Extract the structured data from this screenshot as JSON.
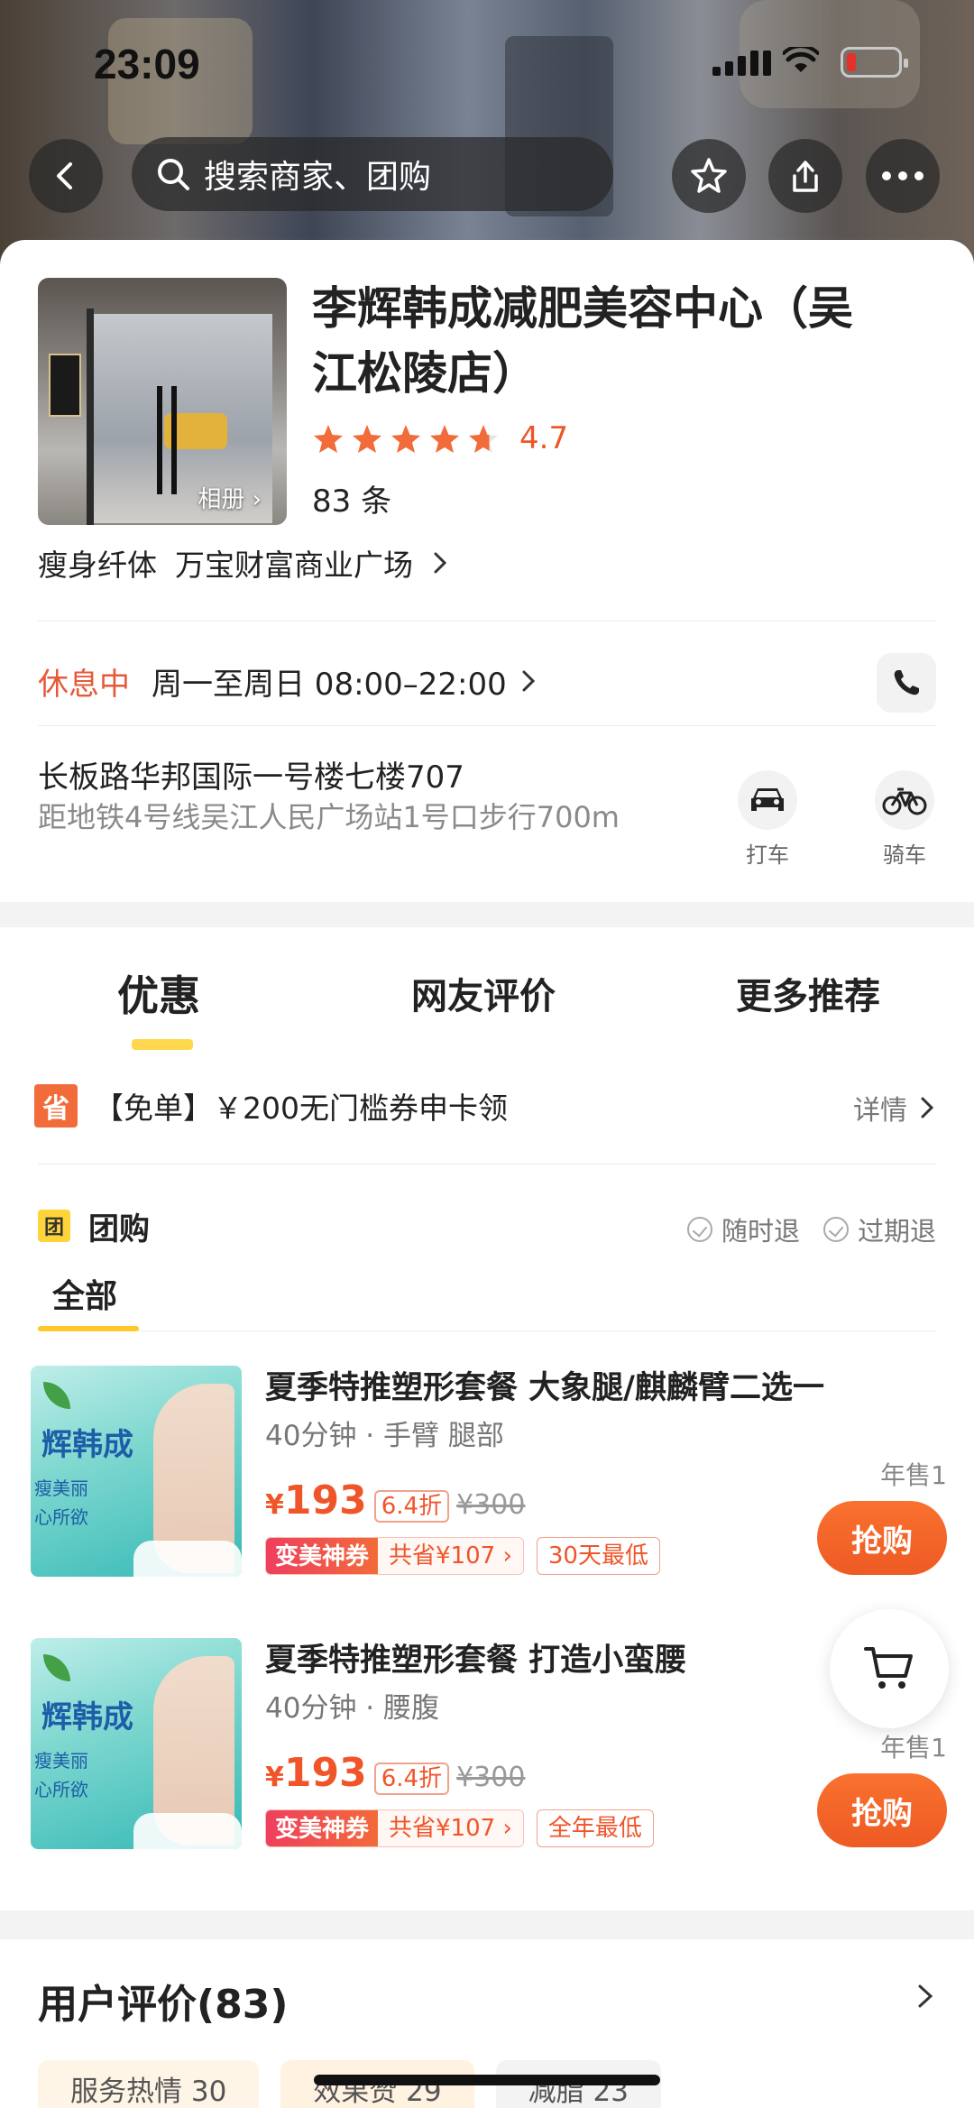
{
  "status_bar": {
    "time": "23:09"
  },
  "search": {
    "placeholder": "搜索商家、团购"
  },
  "shop": {
    "name": "李辉韩成减肥美容中心（吴江松陵店）",
    "name_line1": "李辉韩成减肥美容中心（吴",
    "name_line2": "江松陵店）",
    "rating": "4.7",
    "review_count": "83 条",
    "album_label": "相册 ›",
    "category": "瘦身纤体",
    "mall": "万宝财富商业广场",
    "hours_status": "休息中",
    "hours": "周一至周日 08:00–22:00",
    "address": "长板路华邦国际一号楼七楼707",
    "distance": "距地铁4号线吴江人民广场站1号口步行700m",
    "route_taxi": "打车",
    "route_bike": "骑车"
  },
  "tabs": [
    "优惠",
    "网友评价",
    "更多推荐"
  ],
  "coupon": {
    "badge": "省",
    "text": "【免单】￥200无门槛券申卡领",
    "detail": "详情"
  },
  "group": {
    "badge": "团",
    "title": "团购",
    "refund_any": "随时退",
    "refund_expire": "过期退",
    "subtab": "全部"
  },
  "deals": [
    {
      "title": "夏季特推塑形套餐 大象腿/麒麟臂二选一",
      "meta": "40分钟 · 手臂 腿部",
      "price_symbol": "¥",
      "price": "193",
      "discount": "6.4折",
      "original": "¥300",
      "tag_left": "变美神券",
      "tag_right": "共省¥107 ›",
      "tag_extra": "30天最低",
      "sales": "年售1",
      "buy": "抢购",
      "img_brand": "辉韩成",
      "img_sub1": "瘦美丽",
      "img_sub2": "心所欲"
    },
    {
      "title": "夏季特推塑形套餐 打造小蛮腰",
      "meta": "40分钟 · 腰腹",
      "price_symbol": "¥",
      "price": "193",
      "discount": "6.4折",
      "original": "¥300",
      "tag_left": "变美神券",
      "tag_right": "共省¥107 ›",
      "tag_extra": "全年最低",
      "sales": "年售1",
      "buy": "抢购",
      "img_brand": "辉韩成",
      "img_sub1": "瘦美丽",
      "img_sub2": "心所欲"
    }
  ],
  "reviews": {
    "title": "用户评价(83)",
    "chips": [
      "服务热情 30",
      "效果赞 29",
      "减脂 23"
    ]
  },
  "colors": {
    "accent": "#f0552a",
    "highlight": "#ffd43b",
    "closed": "#e65a3a"
  }
}
